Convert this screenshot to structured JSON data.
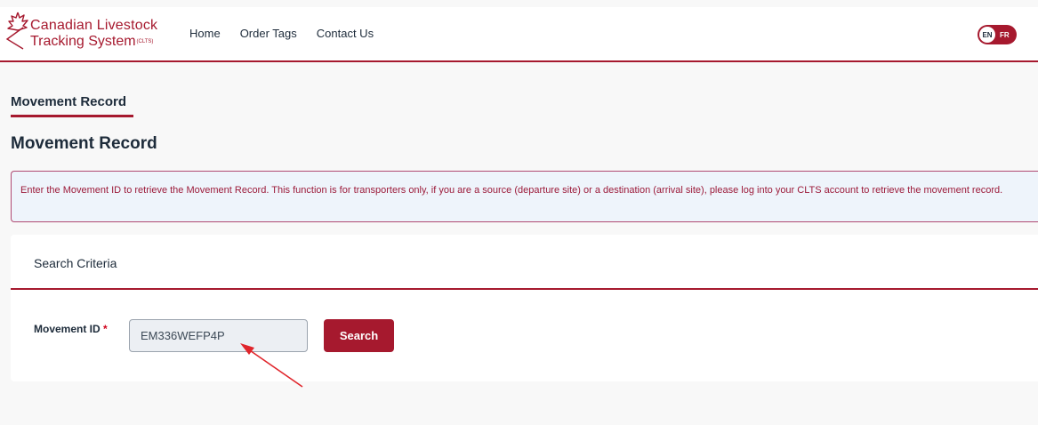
{
  "header": {
    "logo": {
      "line1": "Canadian Livestock",
      "line2": "Tracking System",
      "suffix": "(CLTS)"
    },
    "nav": [
      {
        "label": "Home"
      },
      {
        "label": "Order Tags"
      },
      {
        "label": "Contact Us"
      }
    ],
    "language": {
      "active": "EN",
      "other": "FR"
    }
  },
  "tab": {
    "label": "Movement Record"
  },
  "page_title": "Movement Record",
  "alert": {
    "text": "Enter the Movement ID to retrieve the Movement Record. This function is for transporters only, if you are a source (departure site) or a destination (arrival site), please log into your CLTS account to retrieve the movement record."
  },
  "search_card": {
    "title": "Search Criteria",
    "field_label": "Movement ID",
    "required_marker": "*",
    "field_value": "EM336WEFP4P",
    "button_label": "Search"
  },
  "colors": {
    "brand": "#a6192e",
    "alert_background": "#eef4fb",
    "annotation_arrow": "#e0252b"
  }
}
